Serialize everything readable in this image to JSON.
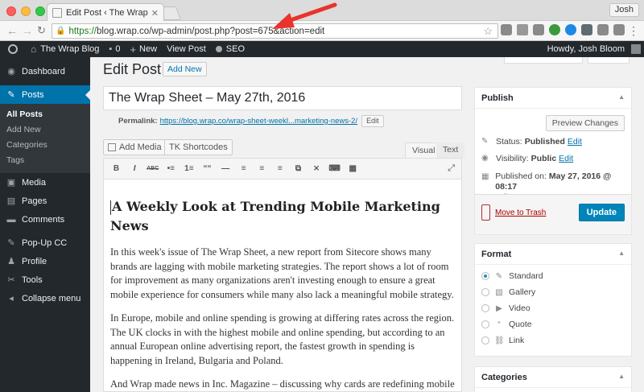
{
  "browser": {
    "tab_title": "Edit Post ‹ The Wrap Blog",
    "profile_name": "Josh",
    "url_prefix": "https://",
    "url_host": "blog.wrap.co",
    "url_path": "/wp-admin/post.php?post=675&action=edit"
  },
  "adminbar": {
    "site_name": "The Wrap Blog",
    "comments_count": "0",
    "new_label": "New",
    "view_post_label": "View Post",
    "seo_label": "SEO",
    "howdy": "Howdy, Josh Bloom"
  },
  "sidebar": {
    "items": [
      {
        "label": "Dashboard",
        "icon": "dashboard-icon"
      },
      {
        "label": "Posts",
        "icon": "pin-icon"
      },
      {
        "label": "Media",
        "icon": "media-icon"
      },
      {
        "label": "Pages",
        "icon": "pages-icon"
      },
      {
        "label": "Comments",
        "icon": "comments-icon"
      },
      {
        "label": "Pop-Up CC",
        "icon": "pin-icon"
      },
      {
        "label": "Profile",
        "icon": "profile-icon"
      },
      {
        "label": "Tools",
        "icon": "tools-icon"
      },
      {
        "label": "Collapse menu",
        "icon": "collapse-icon"
      }
    ],
    "posts_submenu": [
      "All Posts",
      "Add New",
      "Categories",
      "Tags"
    ]
  },
  "main": {
    "page_title": "Edit Post",
    "add_new_label": "Add New",
    "post_title": "The Wrap Sheet – May 27th, 2016",
    "permalink_label": "Permalink:",
    "permalink_url": "https://blog.wrap.co/wrap-sheet-weekl...marketing-news-2/",
    "permalink_edit": "Edit",
    "add_media_label": "Add Media",
    "tk_shortcodes_label": "TK Shortcodes",
    "tab_visual": "Visual",
    "tab_text": "Text",
    "toolbar": [
      "B",
      "I",
      "ABC",
      "•≡",
      "1≡",
      "““",
      "—",
      "≡",
      "≡",
      "≡",
      "⧉",
      "⨯",
      "⌨",
      "▦"
    ],
    "content": {
      "heading": "A Weekly Look at Trending Mobile Marketing News",
      "paragraphs": [
        "In this week's issue of The Wrap Sheet, a new report from Sitecore shows many brands are lagging with mobile marketing strategies. The report shows a lot of room for improvement as many organizations aren't investing enough to ensure a great mobile experience for consumers while many also lack a meaningful mobile strategy.",
        "In Europe, mobile and online spending is growing at differing rates across the region. The UK clocks in with the highest mobile and online spending, but according to an annual European online advertising report, the fastest growth in spending is happening in Ireland, Bulgaria and Poland.",
        "And Wrap made news in Inc. Magazine – discussing why cards are redefining mobile"
      ]
    }
  },
  "publish": {
    "title": "Publish",
    "preview_label": "Preview Changes",
    "status_label": "Status:",
    "status_value": "Published",
    "visibility_label": "Visibility:",
    "visibility_value": "Public",
    "published_label": "Published on:",
    "published_value": "May 27, 2016 @ 08:17",
    "edit_label": "Edit",
    "trash_label": "Move to Trash",
    "update_label": "Update"
  },
  "format": {
    "title": "Format",
    "options": [
      {
        "label": "Standard",
        "icon": "pin-icon",
        "checked": true
      },
      {
        "label": "Gallery",
        "icon": "gallery-icon",
        "checked": false
      },
      {
        "label": "Video",
        "icon": "video-icon",
        "checked": false
      },
      {
        "label": "Quote",
        "icon": "quote-icon",
        "checked": false
      },
      {
        "label": "Link",
        "icon": "link-icon",
        "checked": false
      }
    ]
  },
  "categories": {
    "title": "Categories"
  },
  "colors": {
    "accent": "#0073aa",
    "update_button": "#0085ba",
    "adminbar": "#23282d",
    "annotation_arrow": "#e8342c"
  }
}
